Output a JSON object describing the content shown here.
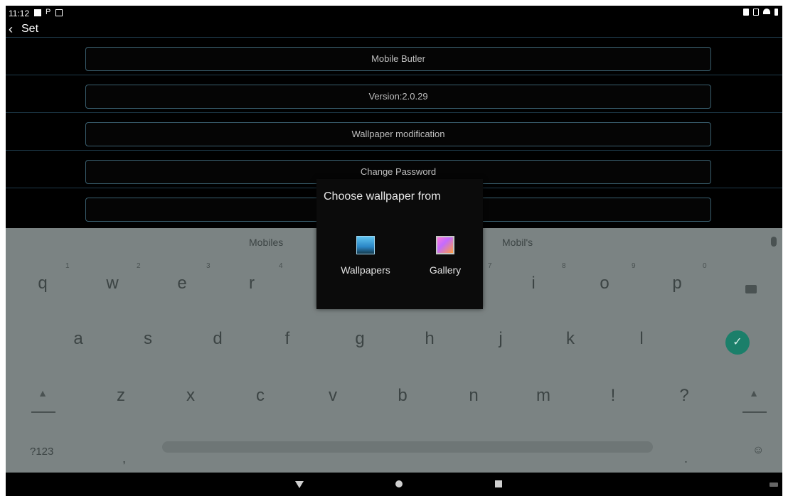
{
  "status_bar": {
    "time": "11:12"
  },
  "title_bar": {
    "back_label": "Set"
  },
  "settings_items": [
    {
      "label": "Mobile Butler"
    },
    {
      "label": "Version:2.0.29"
    },
    {
      "label": "Wallpaper modification"
    },
    {
      "label": "Change Password"
    },
    {
      "label": ""
    }
  ],
  "keyboard": {
    "suggestions": [
      "Mobiles",
      "Mobil's"
    ],
    "row1": [
      "q",
      "w",
      "e",
      "r",
      "",
      "",
      "",
      "i",
      "o",
      "p"
    ],
    "row1_hints": [
      "1",
      "2",
      "3",
      "4",
      "",
      "",
      "7",
      "8",
      "9",
      "0"
    ],
    "row2": [
      "a",
      "s",
      "d",
      "f",
      "g",
      "h",
      "j",
      "k",
      "l"
    ],
    "row3": [
      "z",
      "x",
      "c",
      "v",
      "b",
      "n",
      "m",
      "!",
      "?"
    ],
    "symbols_label": "?123",
    "comma": ",",
    "period": ".",
    "emoji": "☺"
  },
  "dialog": {
    "title": "Choose wallpaper from",
    "options": [
      {
        "label": "Wallpapers",
        "icon": "wallpapers-icon"
      },
      {
        "label": "Gallery",
        "icon": "gallery-icon"
      }
    ]
  },
  "colors": {
    "background": "#000000",
    "keyboard": "#7b8383",
    "accent": "#1b7f6a"
  }
}
